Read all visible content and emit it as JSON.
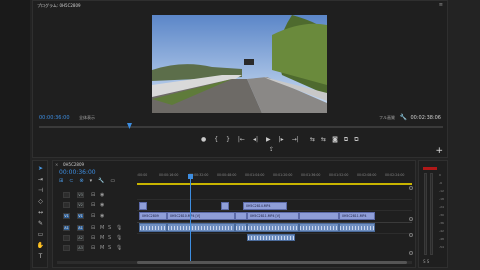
{
  "program": {
    "title": "プログラム: 0H5C2809",
    "menu": "≡",
    "timecode": "00:00:36:00",
    "fit": "全体表示",
    "quality": "フル画質",
    "duration": "00:02:38:06",
    "playhead_fraction": 0.23
  },
  "transport": {
    "buttons": [
      "●",
      "{",
      "}",
      "|←",
      "◂|",
      "▶",
      "|▸",
      "→|"
    ],
    "right_buttons": [
      "⇆",
      "⇆",
      "📷",
      "⧉",
      "⧉"
    ],
    "export": "⇪",
    "add": "+"
  },
  "timeline": {
    "sequence_tab": "0H5C2809",
    "timecode": "00:00:36:00",
    "ruler_labels": [
      ":00:00",
      "00:00:16:00",
      "00:00:32:00",
      "00:00:48:00",
      "00:01:04:00",
      "00:01:20:00",
      "00:01:36:00",
      "00:01:52:00",
      "00:02:08:00",
      "00:02:24:00",
      "00:02:40:00"
    ],
    "tracks": [
      {
        "name": "V3",
        "src": "",
        "type": "video"
      },
      {
        "name": "V2",
        "src": "",
        "type": "video"
      },
      {
        "name": "V1",
        "src": "V1",
        "type": "video"
      },
      {
        "name": "A1",
        "src": "A1",
        "type": "audio"
      },
      {
        "name": "A2",
        "src": "",
        "type": "audio"
      },
      {
        "name": "A3",
        "src": "",
        "type": "audio"
      }
    ],
    "clips_v1": [
      "0H5C2809",
      "0H5C2810.MP4 [V]",
      "0H5C2811.MP4 [V]",
      "0H5C2811.MP4"
    ],
    "clip_v2": "0H5C2814.MP4"
  },
  "tools": [
    "selection-tool",
    "track-select-tool",
    "ripple-edit-tool",
    "razor-tool",
    "slip-tool",
    "pen-tool",
    "hand-tool",
    "type-tool"
  ],
  "meter": {
    "scale": [
      "0",
      "-6",
      "-12",
      "-18",
      "-24",
      "-30",
      "-36",
      "-42",
      "-48",
      "-54"
    ],
    "footer": "S  S"
  },
  "colors": {
    "accent": "#3d8de0",
    "clip_video": "#8f9ed8",
    "clip_audio": "#6f8fc0"
  }
}
